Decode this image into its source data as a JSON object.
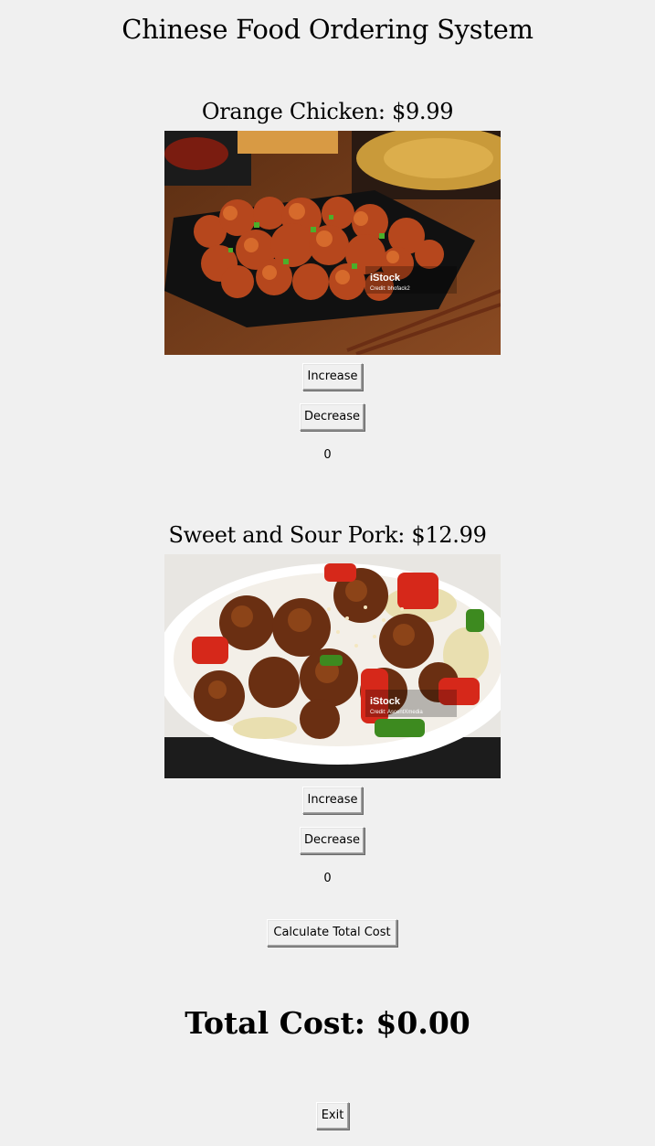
{
  "app": {
    "title": "Chinese Food Ordering System"
  },
  "items": [
    {
      "heading": "Orange Chicken: $9.99",
      "image_icon": "orange-chicken-photo",
      "watermark": "iStock",
      "watermark_credit": "Credit: bhofack2",
      "increase_label": "Increase",
      "decrease_label": "Decrease",
      "quantity": "0"
    },
    {
      "heading": "Sweet and Sour Pork: $12.99",
      "image_icon": "sweet-and-sour-pork-photo",
      "watermark": "iStock",
      "watermark_credit": "Credit: AscentXmedia",
      "increase_label": "Increase",
      "decrease_label": "Decrease",
      "quantity": "0"
    }
  ],
  "actions": {
    "calculate_label": "Calculate Total Cost",
    "exit_label": "Exit"
  },
  "summary": {
    "total_text": "Total Cost: $0.00"
  }
}
